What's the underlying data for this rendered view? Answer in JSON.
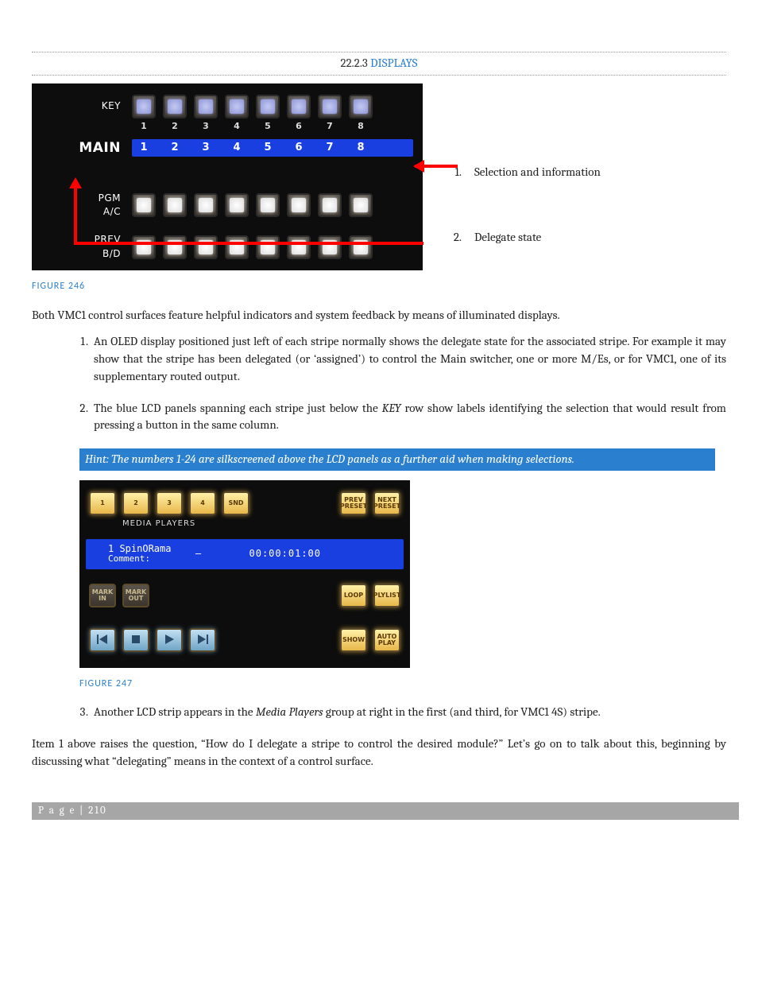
{
  "section": {
    "number": "22.2.3",
    "title": "DISPLAYS"
  },
  "figure246": {
    "caption": "FIGURE 246",
    "rows": {
      "key": {
        "label": "KEY"
      },
      "main": {
        "label": "MAIN"
      },
      "pgm": {
        "label_top": "PGM",
        "label_bot": "A/C"
      },
      "prev": {
        "label_top": "PREV",
        "label_bot": "B/D"
      }
    },
    "silk_numbers": [
      "1",
      "2",
      "3",
      "4",
      "5",
      "6",
      "7",
      "8"
    ],
    "lcd_numbers": [
      "1",
      "2",
      "3",
      "4",
      "5",
      "6",
      "7",
      "8"
    ],
    "callouts": [
      {
        "n": "1.",
        "text": "Selection and information"
      },
      {
        "n": "2.",
        "text": "Delegate state"
      }
    ]
  },
  "intro_para": "Both VMC1 control surfaces feature helpful indicators and system feedback by means of illuminated displays.",
  "list1": [
    {
      "pre": "An OLED display positioned just left of each stripe normally shows the delegate state for the associated stripe.  For example it may show that the stripe has been delegated (or ‘assigned’) to control the Main switcher, one or more M/Es, or for VMC1, one of its supplementary routed output."
    },
    {
      "pre": "The blue LCD panels spanning each stripe just below the ",
      "em": "KEY",
      "post": " row show labels identifying the selection that would result from pressing a button in the same column."
    }
  ],
  "hint": "Hint: The numbers 1-24 are silkscreened above the LCD panels as a further aid when making selections.",
  "figure247": {
    "caption": "FIGURE 247",
    "media_players_label": "MEDIA PLAYERS",
    "row1_left": [
      "1",
      "2",
      "3",
      "4",
      "SND"
    ],
    "row1_right": [
      "PREV\nPRESET",
      "NEXT\nPRESET"
    ],
    "lcd": {
      "line1": "1 SpinORama",
      "line2": "Comment:",
      "dash": "–",
      "tc": "00:00:01:00"
    },
    "row3_left": [
      "MARK\nIN",
      "MARK\nOUT"
    ],
    "row3_right": [
      "LOOP",
      "PLYLIST"
    ],
    "row4_right": [
      "SHOW",
      "AUTO\nPLAY"
    ]
  },
  "list2": [
    {
      "pre": "Another LCD strip appears in the ",
      "em": "Media Players",
      "post": " group at right in the first (and third, for VMC1 4S) stripe."
    }
  ],
  "closing": "Item 1 above raises the question, “How do I delegate a stripe to control the desired module?” Let’s go on to talk about this, beginning by discussing what “delegating” means in the context of a control surface.",
  "footer": "P a g e  | 210"
}
